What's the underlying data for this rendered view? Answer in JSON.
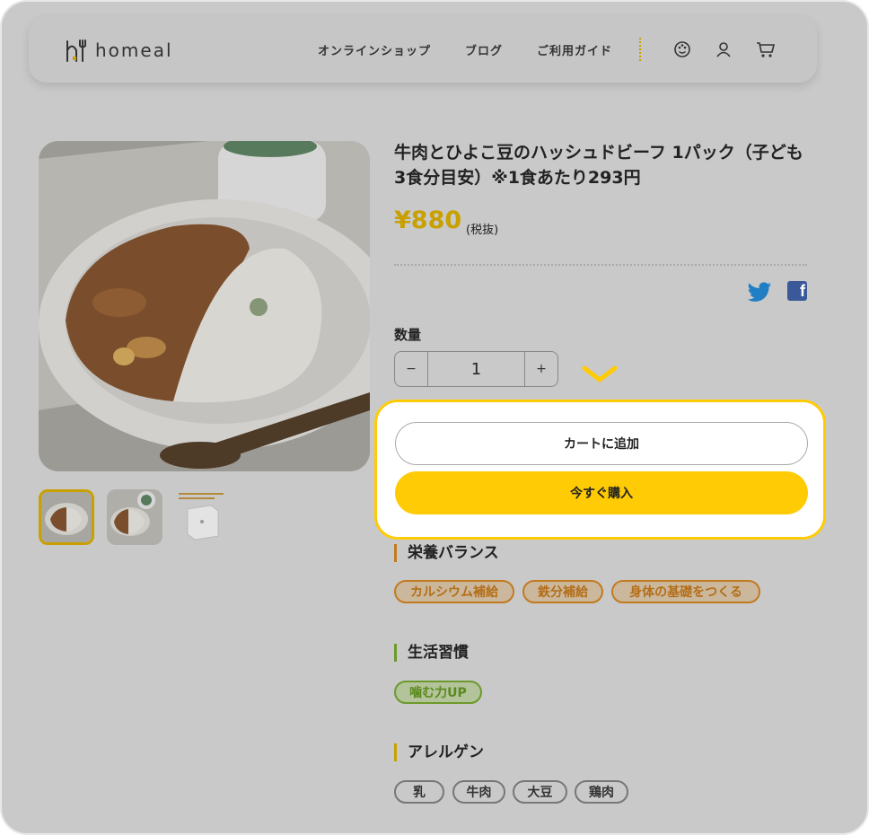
{
  "brand": {
    "logo_text": "homeal"
  },
  "nav": {
    "links": [
      "オンラインショップ",
      "ブログ",
      "ご利用ガイド"
    ]
  },
  "product": {
    "title": "牛肉とひよこ豆のハッシュドビーフ 1パック（子ども3食分目安）※1食あたり293円",
    "price": "¥880",
    "tax_note": "(税抜)",
    "quantity_label": "数量",
    "quantity_value": "1",
    "minus": "−",
    "plus": "+"
  },
  "actions": {
    "add_to_cart": "カートに追加",
    "buy_now": "今すぐ購入"
  },
  "sections": {
    "nutrition": {
      "heading": "栄養バランス",
      "tags": [
        "カルシウム補給",
        "鉄分補給",
        "身体の基礎をつくる"
      ]
    },
    "habits": {
      "heading": "生活習慣",
      "tags": [
        "噛む力UP"
      ]
    },
    "allergens": {
      "heading": "アレルゲン",
      "tags": [
        "乳",
        "牛肉",
        "大豆",
        "鶏肉"
      ]
    }
  },
  "colors": {
    "accent": "#ffcb05",
    "nutrition": "#c27a20",
    "habits": "#6c9a2c",
    "overlay": "#c9c9c9"
  }
}
